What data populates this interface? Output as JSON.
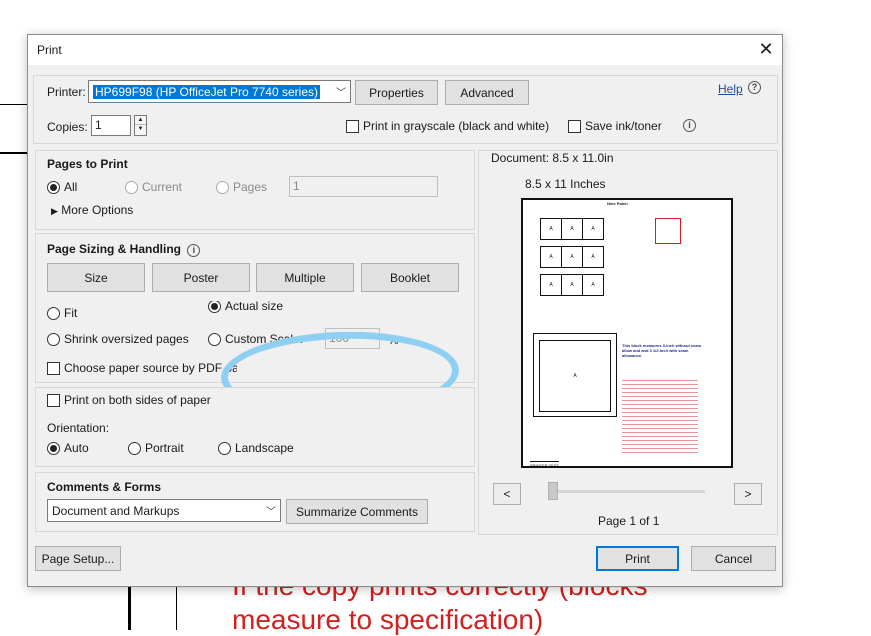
{
  "background": {
    "text_line1": "If the copy prints correctly (blocks",
    "text_line2": "measure to specification)",
    "text_color": "#d21f1f"
  },
  "dialog": {
    "title": "Print",
    "close_icon": "close-icon"
  },
  "printer": {
    "label": "Printer:",
    "selected": "HP699F98 (HP OfficeJet Pro 7740 series)",
    "properties_label": "Properties",
    "advanced_label": "Advanced",
    "help_label": "Help",
    "help_icon": "question-circle-icon"
  },
  "copies": {
    "label": "Copies:",
    "value": "1"
  },
  "options": {
    "grayscale_label": "Print in grayscale (black and white)",
    "grayscale_checked": false,
    "save_ink_label": "Save ink/toner",
    "save_ink_checked": false,
    "info_icon": "info-icon"
  },
  "pages_to_print": {
    "heading": "Pages to Print",
    "all_label": "All",
    "current_label": "Current",
    "pages_label": "Pages",
    "pages_value": "1",
    "selected": "All",
    "more_options_label": "More Options"
  },
  "page_sizing": {
    "heading": "Page Sizing & Handling",
    "buttons": [
      "Size",
      "Poster",
      "Multiple",
      "Booklet"
    ],
    "fit_label": "Fit",
    "actual_size_label": "Actual size",
    "shrink_label": "Shrink oversized pages",
    "custom_scale_label": "Custom Scale:",
    "custom_scale_value": "100",
    "custom_scale_unit": "%",
    "choose_paper_label": "Choose paper source by PDF page size",
    "selected": "Actual size",
    "highlight_color": "#8fd0f2"
  },
  "duplex": {
    "label": "Print on both sides of paper",
    "checked": false
  },
  "orientation": {
    "label": "Orientation:",
    "options": [
      "Auto",
      "Portrait",
      "Landscape"
    ],
    "selected": "Auto"
  },
  "comments": {
    "heading": "Comments & Forms",
    "selected": "Document and Markups",
    "summarize_label": "Summarize Comments"
  },
  "preview": {
    "document_label": "Document: 8.5 x 11.0in",
    "size_label": "8.5 x 11 Inches",
    "page_counter": "Page 1 of 1",
    "prev_label": "<",
    "next_label": ">",
    "mini_page": {
      "title": "Nine Patch",
      "grid_letter": "A",
      "block_letter": "A",
      "measure_text": "This block measures 3-inch without seam allow and and 3 1/2-inch with seam allowance.",
      "footer": "PRINTER TEST"
    }
  },
  "footer": {
    "page_setup_label": "Page Setup...",
    "print_label": "Print",
    "cancel_label": "Cancel"
  }
}
